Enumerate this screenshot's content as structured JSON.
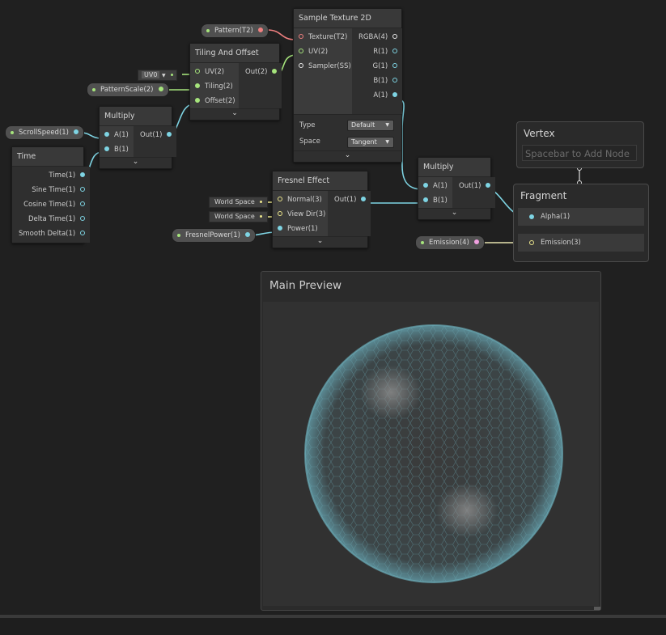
{
  "properties": {
    "pattern": "Pattern(T2)",
    "pattern_scale": "PatternScale(2)",
    "scroll_speed": "ScrollSpeed(1)",
    "fresnel_power": "FresnelPower(1)",
    "emission": "Emission(4)"
  },
  "sample_texture": {
    "title": "Sample Texture 2D",
    "inputs": [
      "Texture(T2)",
      "UV(2)",
      "Sampler(SS)"
    ],
    "outputs": [
      "RGBA(4)",
      "R(1)",
      "G(1)",
      "B(1)",
      "A(1)"
    ],
    "type_label": "Type",
    "type_value": "Default",
    "space_label": "Space",
    "space_value": "Tangent"
  },
  "tiling_offset": {
    "title": "Tiling And Offset",
    "inputs": [
      "UV(2)",
      "Tiling(2)",
      "Offset(2)"
    ],
    "output": "Out(2)",
    "uv_dropdown": "UV0"
  },
  "multiply1": {
    "title": "Multiply",
    "inputs": [
      "A(1)",
      "B(1)"
    ],
    "output": "Out(1)"
  },
  "time": {
    "title": "Time",
    "outputs": [
      "Time(1)",
      "Sine Time(1)",
      "Cosine Time(1)",
      "Delta Time(1)",
      "Smooth Delta(1)"
    ]
  },
  "fresnel": {
    "title": "Fresnel Effect",
    "inputs": [
      "Normal(3)",
      "View Dir(3)",
      "Power(1)"
    ],
    "output": "Out(1)",
    "normal_field": "World Space",
    "viewdir_field": "World Space"
  },
  "multiply2": {
    "title": "Multiply",
    "inputs": [
      "A(1)",
      "B(1)"
    ],
    "output": "Out(1)"
  },
  "vertex": {
    "title": "Vertex",
    "placeholder": "Spacebar to Add Node"
  },
  "fragment": {
    "title": "Fragment",
    "alpha": "Alpha(1)",
    "emission": "Emission(3)"
  },
  "preview": {
    "title": "Main Preview"
  },
  "colors": {
    "float_port": "#7ed4e3",
    "vector2_port": "#a6e47c",
    "texture_port": "#f08080",
    "vector3_port": "#ece68c",
    "color_port": "#f0a0e0"
  }
}
